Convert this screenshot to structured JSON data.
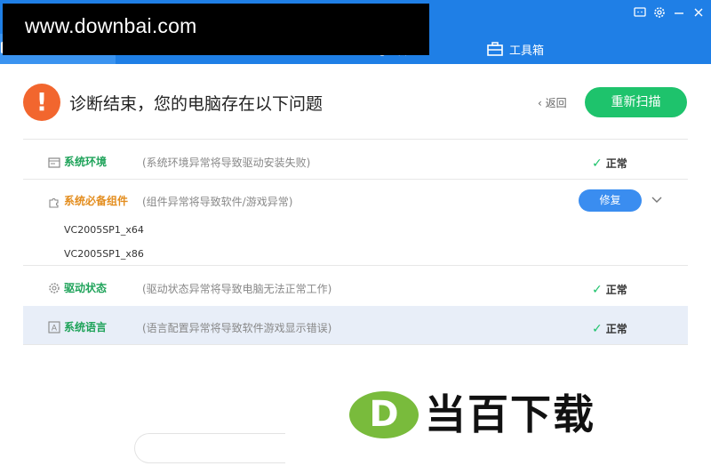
{
  "header": {
    "tabs": [
      {
        "label": "",
        "icon": "monitor-icon",
        "active": true
      },
      {
        "label": "",
        "icon": "chip-icon"
      },
      {
        "label": "",
        "icon": "wrench-icon"
      },
      {
        "label": "管理",
        "icon": "mouse-icon"
      },
      {
        "label": "工具箱",
        "icon": "toolbox-icon"
      }
    ],
    "window_controls": [
      "feedback-icon",
      "settings-icon",
      "minimize-icon",
      "close-icon"
    ],
    "accent_color": "#1f7fe6"
  },
  "watermark": {
    "text": "www.downbai.com"
  },
  "result": {
    "title": "诊断结束，您的电脑存在以下问题",
    "warn_glyph": "!",
    "back_label": "返回",
    "rescan_label": "重新扫描"
  },
  "rows": [
    {
      "name": "系统环境",
      "desc": "(系统环境异常将导致驱动安装失败)",
      "status": "正常",
      "icon": "window-icon"
    },
    {
      "name": "系统必备组件",
      "desc": "(组件异常将导致软件/游戏异常)",
      "action": "修复",
      "icon": "puzzle-icon",
      "sub_items": [
        "VC2005SP1_x64",
        "VC2005SP1_x86"
      ]
    },
    {
      "name": "驱动状态",
      "desc": "(驱动状态异常将导致电脑无法正常工作)",
      "status": "正常",
      "icon": "gear-icon"
    },
    {
      "name": "系统语言",
      "desc": "(语言配置异常将导致软件游戏显示错误)",
      "status": "正常",
      "icon": "letter-a-icon"
    }
  ],
  "logo": {
    "letter": "D",
    "text": "当百下载"
  },
  "colors": {
    "ok": "#1ec36c",
    "warn": "#e38d1e",
    "repair": "#3a8df0",
    "rescan": "#1ec36c",
    "alert": "#f2662e"
  }
}
